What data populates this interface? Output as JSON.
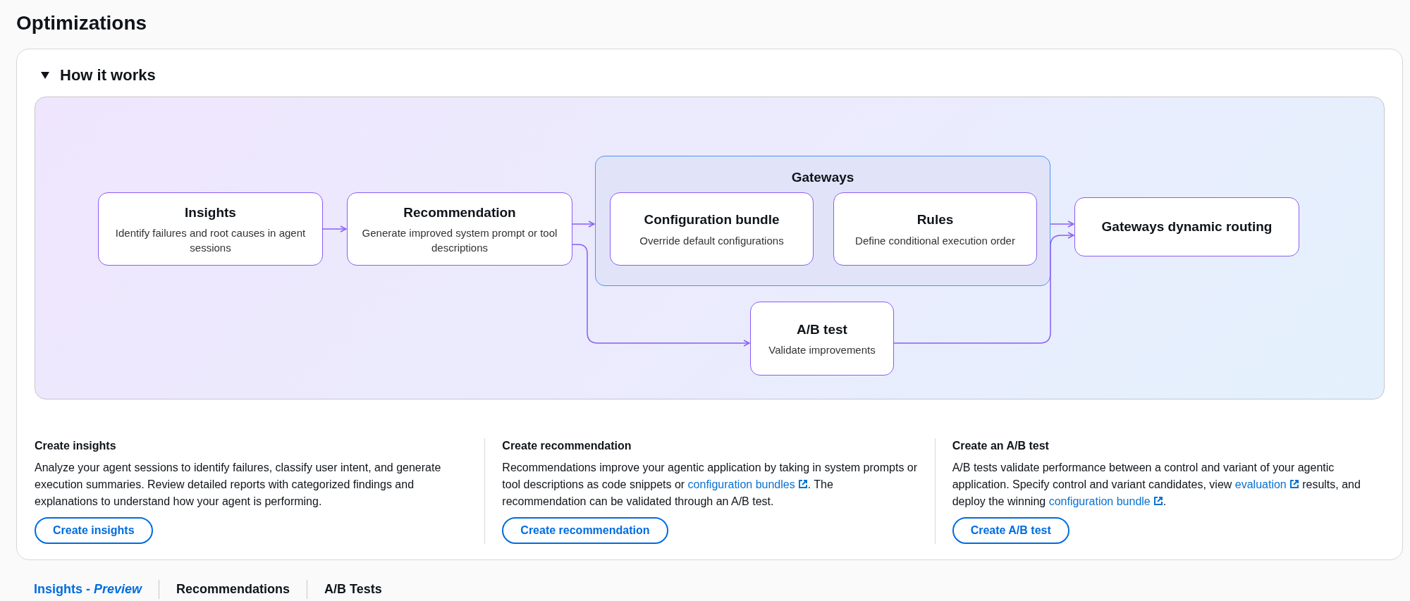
{
  "page_title": "Optimizations",
  "how_it_works": {
    "title": "How it works",
    "expanded": true
  },
  "diagram": {
    "group": {
      "title": "Gateways"
    },
    "nodes": [
      {
        "title": "Insights",
        "description": "Identify failures and root causes in agent sessions"
      },
      {
        "title": "Recommendation",
        "description": "Generate improved system prompt or tool descriptions"
      },
      {
        "title": "Configuration bundle",
        "description": "Override default configurations"
      },
      {
        "title": "Rules",
        "description": "Define conditional execution order"
      },
      {
        "title": "Gateways dynamic routing"
      },
      {
        "title": "A/B test",
        "description": "Validate improvements"
      }
    ]
  },
  "sections": [
    {
      "title": "Create insights",
      "body": [
        {
          "kind": "text",
          "text": "Analyze your agent sessions to identify failures, classify user intent, and generate execution summaries. Review detailed reports with categorized findings and explanations to understand how your agent is performing."
        }
      ],
      "button": "Create insights"
    },
    {
      "title": "Create recommendation",
      "body": [
        {
          "kind": "text",
          "text": "Recommendations improve your agentic application by taking in system prompts or tool descriptions as code snippets or "
        },
        {
          "kind": "link",
          "text": "configuration bundles"
        },
        {
          "kind": "text",
          "text": ". The recommendation can be validated through an A/B test."
        }
      ],
      "button": "Create recommendation"
    },
    {
      "title": "Create an A/B test",
      "body": [
        {
          "kind": "text",
          "text": "A/B tests validate performance between a control and variant of your agentic application. Specify control and variant candidates, view "
        },
        {
          "kind": "link",
          "text": "evaluation"
        },
        {
          "kind": "text",
          "text": " results, and deploy the winning "
        },
        {
          "kind": "link",
          "text": "configuration bundle"
        },
        {
          "kind": "text",
          "text": "."
        }
      ],
      "button": "Create A/B test"
    }
  ],
  "tabs": [
    {
      "label": "Insights - *Preview*",
      "selected": true
    },
    {
      "label": "Recommendations",
      "selected": false
    },
    {
      "label": "A/B Tests",
      "selected": false
    }
  ]
}
